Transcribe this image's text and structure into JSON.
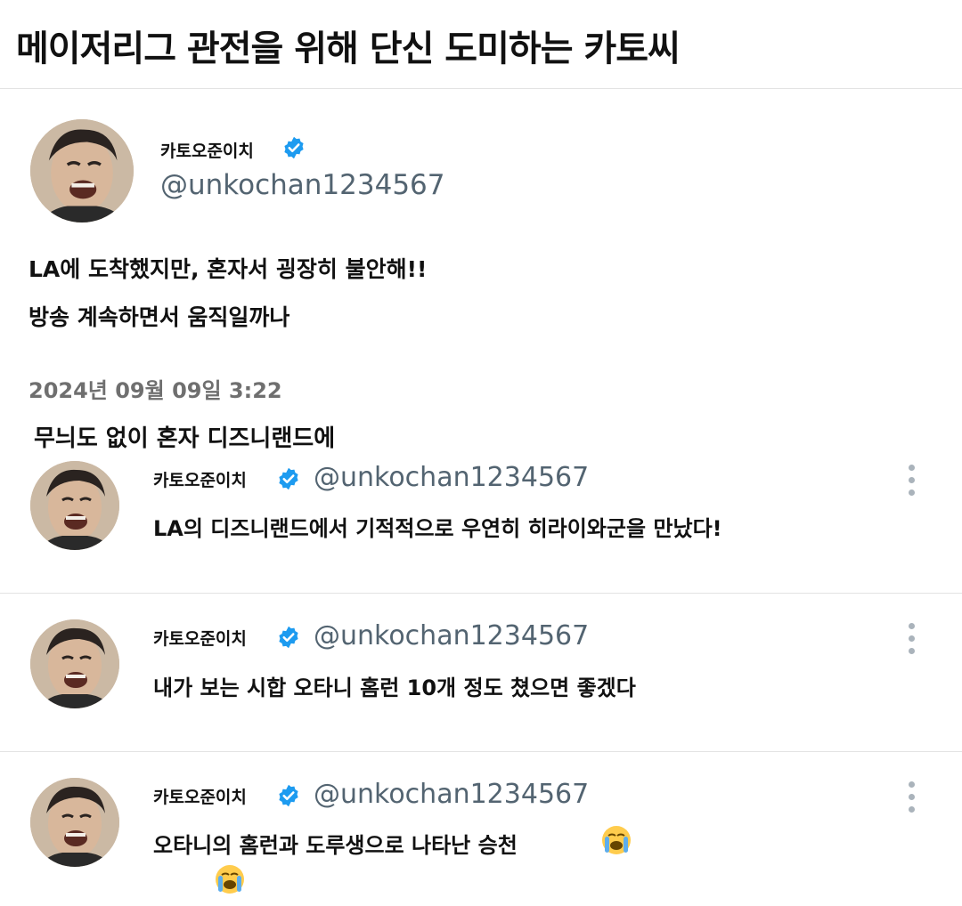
{
  "page_title": "메이저리그 관전을 위해 단신 도미하는 카토씨",
  "main_tweet": {
    "display_name": "카토오준이치",
    "handle": "@unkochan1234567",
    "lines": [
      "LA에 도착했지만, 혼자서 굉장히 불안해!!",
      "방송 계속하면서 움직일까나"
    ],
    "timestamp": "2024년 09월 09일 3:22"
  },
  "caption": "무늬도 없이 혼자 디즈니랜드에",
  "replies": [
    {
      "display_name": "카토오준이치",
      "handle": "@unkochan1234567",
      "text": "LA의 디즈니랜드에서 기적적으로 우연히 히라이와군을 만났다!"
    },
    {
      "display_name": "카토오준이치",
      "handle": "@unkochan1234567",
      "text": "내가 보는 시합 오타니 홈런 10개 정도 쳤으면 좋겠다"
    },
    {
      "display_name": "카토오준이치",
      "handle": "@unkochan1234567",
      "text": "오타니의 홈런과 도루생으로 나타난 승천"
    }
  ],
  "icons": {
    "verified": "verified-badge-icon",
    "more": "more-vertical-icon",
    "emoji": "loudly-crying-face-icon"
  },
  "colors": {
    "verified": "#1d9bf0",
    "handle": "#536471",
    "divider": "#e3e3e3"
  }
}
